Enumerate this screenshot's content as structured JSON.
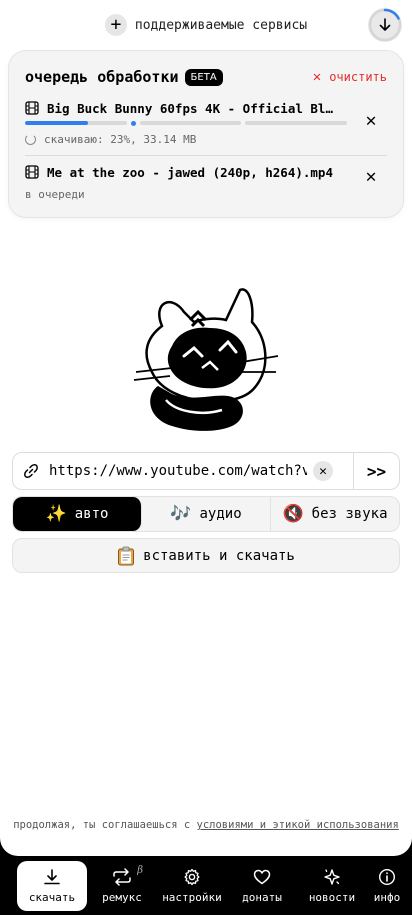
{
  "topbar": {
    "services_label": "поддерживаемые сервисы"
  },
  "queue": {
    "title": "очередь обработки",
    "beta_badge": "БЕТА",
    "clear_label": "очистить",
    "items": [
      {
        "name": "Big Buck Bunny 60fps 4K - Official Bl…",
        "status": "скачиваю: 23%, 33.14 MB",
        "progress": 0.23
      },
      {
        "name": "Me at the zoo - jawed (240p, h264).mp4",
        "status": "в очереди"
      }
    ]
  },
  "link": {
    "value": "https://www.youtube.com/watch?v",
    "go_label": ">>"
  },
  "modes": [
    {
      "emoji": "✨",
      "label": "авто",
      "active": true
    },
    {
      "emoji": "🎶",
      "label": "аудио",
      "active": false
    },
    {
      "emoji": "🔇",
      "label": "без звука",
      "active": false
    }
  ],
  "paste_label": "вставить и скачать",
  "terms": {
    "prefix": "продолжая, ты соглашаешься с ",
    "link": "условиями и этикой использования"
  },
  "nav": [
    {
      "label": "скачать",
      "icon": "download-icon",
      "active": true
    },
    {
      "label": "ремукс",
      "icon": "remux-icon",
      "beta": "β"
    },
    {
      "label": "настройки",
      "icon": "gear-icon"
    },
    {
      "label": "донаты",
      "icon": "heart-icon"
    },
    {
      "label": "новости",
      "icon": "sparkle-star-icon"
    },
    {
      "label": "инфо",
      "icon": "info-icon"
    }
  ],
  "colors": {
    "accent_blue": "#2f80ed",
    "danger_red": "#e0302b",
    "nav_bg": "#000000"
  }
}
